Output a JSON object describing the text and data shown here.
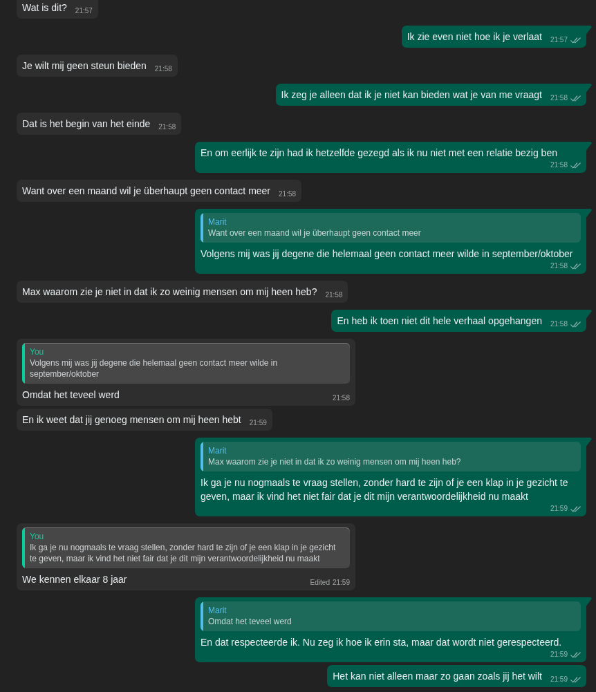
{
  "messages": [
    {
      "kind": "incoming",
      "text": "Wat is dit?",
      "time": "21:57"
    },
    {
      "kind": "outgoing",
      "text": "Ik zie even niet hoe ik je verlaat",
      "time": "21:57",
      "read": false
    },
    {
      "kind": "incoming",
      "text": "Je wilt mij geen steun bieden",
      "time": "21:58"
    },
    {
      "kind": "outgoing",
      "text": "Ik zeg je alleen dat ik je niet kan bieden wat je van me vraagt",
      "time": "21:58",
      "read": false
    },
    {
      "kind": "incoming",
      "text": "Dat is het begin van het einde",
      "time": "21:58"
    },
    {
      "kind": "outgoing",
      "text": "En om eerlijk te zijn had ik hetzelfde gezegd als ik nu niet met een relatie bezig ben",
      "time": "21:58",
      "read": false
    },
    {
      "kind": "incoming",
      "text": "Want over een maand wil je überhaupt geen contact meer",
      "time": "21:58"
    },
    {
      "kind": "outgoing",
      "quote": {
        "sender": "Marit",
        "text": "Want over een maand wil je überhaupt geen contact meer",
        "color": "#53bdeb"
      },
      "text": "Volgens mij was jij degene die helemaal geen contact meer wilde in september/oktober",
      "time": "21:58",
      "read": false
    },
    {
      "kind": "incoming",
      "text": "Max waarom zie je niet in dat ik zo weinig mensen om mij heen heb?",
      "time": "21:58"
    },
    {
      "kind": "outgoing",
      "text": "En heb ik toen niet dit hele verhaal opgehangen",
      "time": "21:58",
      "read": false
    },
    {
      "kind": "incoming",
      "quote": {
        "sender": "You",
        "text": "Volgens mij was jij degene die helemaal geen contact meer wilde in september/oktober",
        "color": "#06cf9c"
      },
      "text": "Omdat het teveel werd",
      "time": "21:58"
    },
    {
      "kind": "incoming",
      "text": "En ik weet dat jij genoeg mensen om mij heen hebt",
      "time": "21:59"
    },
    {
      "kind": "outgoing",
      "quote": {
        "sender": "Marit",
        "text": "Max waarom zie je niet in dat ik zo weinig mensen om mij heen heb?",
        "color": "#53bdeb"
      },
      "text": "Ik ga je nu nogmaals te vraag stellen, zonder hard te zijn of je een klap in je gezicht te geven, maar ik vind het niet fair dat je dit mijn verantwoordelijkheid nu maakt",
      "time": "21:59",
      "read": false
    },
    {
      "kind": "incoming",
      "quote": {
        "sender": "You",
        "text": "Ik ga je nu nogmaals te vraag stellen, zonder hard te zijn of je een klap in je gezicht te geven, maar ik vind het niet fair dat je dit mijn verantwoordelijkheid nu maakt",
        "color": "#06cf9c"
      },
      "text": "We kennen elkaar 8 jaar",
      "edited_label": "Edited",
      "time": "21:59"
    },
    {
      "kind": "outgoing",
      "quote": {
        "sender": "Marit",
        "text": "Omdat het teveel werd",
        "color": "#53bdeb"
      },
      "text": "En dat respecteerde ik. Nu zeg ik hoe ik erin sta, maar dat wordt niet gerespecteerd.",
      "time": "21:59",
      "read": false
    },
    {
      "kind": "outgoing",
      "text": "Het kan niet alleen maar zo gaan zoals jij het wilt",
      "time": "21:59",
      "read": false
    }
  ]
}
